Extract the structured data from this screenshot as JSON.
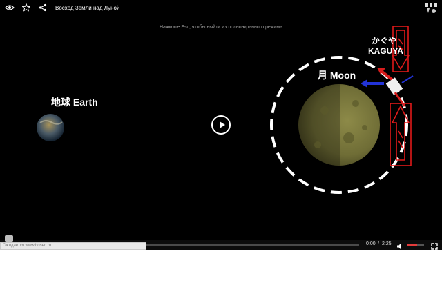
{
  "header": {
    "title": "Восход Земли над Луной"
  },
  "icons": {
    "eye": "eye-icon",
    "star": "star-icon",
    "share": "share-icon",
    "logo": "logo-icon",
    "play": "play-icon",
    "volume": "volume-icon",
    "fullscreen": "fullscreen-icon"
  },
  "overlay": {
    "esc_hint": "Нажмите Esc, чтобы выйти из полноэкранного режима"
  },
  "scene": {
    "earth_label": "地球 Earth",
    "moon_label": "月  Moon",
    "kaguya_jp": "かぐや",
    "kaguya_en": "KAGUYA"
  },
  "controls": {
    "current_time": "0:00",
    "separator": "/",
    "duration": "2:25",
    "volume_level": 0.6
  },
  "status": {
    "text": "Ожидается www.hosen.ru"
  },
  "colors": {
    "background": "#000000",
    "accent": "#e43b3b",
    "moon": "#6f6d36"
  }
}
